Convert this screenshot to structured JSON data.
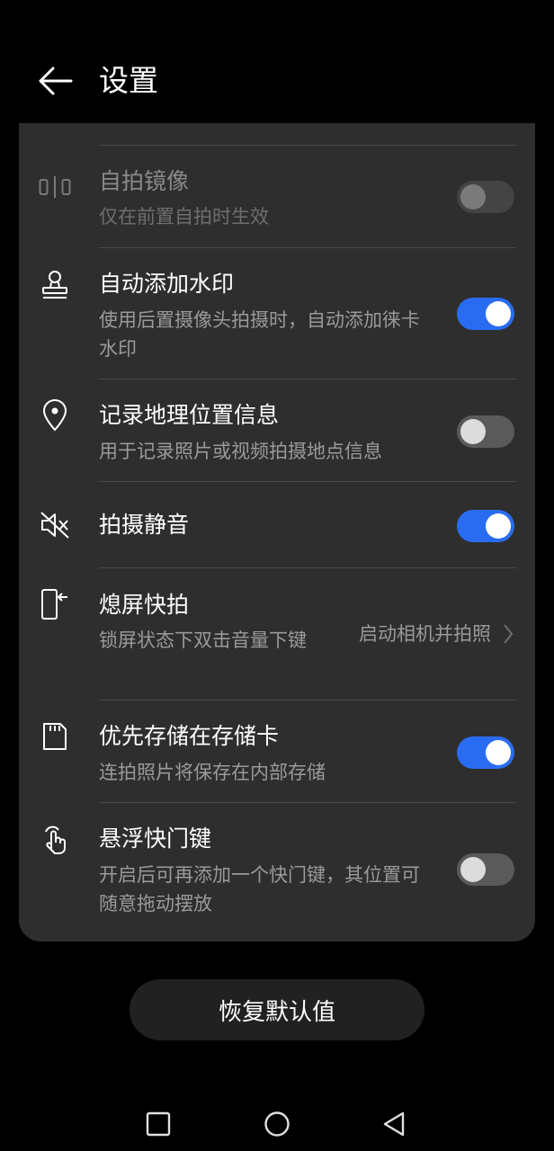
{
  "header": {
    "title": "设置",
    "back_icon": "arrow-left-icon"
  },
  "settings": [
    {
      "id": "mirror",
      "title": "自拍镜像",
      "subtitle": "仅在前置自拍时生效",
      "icon": "mirror-icon",
      "control": "toggle",
      "state": "off",
      "disabled": true
    },
    {
      "id": "watermark",
      "title": "自动添加水印",
      "subtitle": "使用后置摄像头拍摄时，自动添加徕卡水印",
      "icon": "stamp-icon",
      "control": "toggle",
      "state": "on"
    },
    {
      "id": "location",
      "title": "记录地理位置信息",
      "subtitle": "用于记录照片或视频拍摄地点信息",
      "icon": "location-pin-icon",
      "control": "toggle",
      "state": "off"
    },
    {
      "id": "mute",
      "title": "拍摄静音",
      "subtitle": "",
      "icon": "mute-speaker-icon",
      "control": "toggle",
      "state": "on"
    },
    {
      "id": "quick_snap",
      "title": "熄屏快拍",
      "subtitle": "锁屏状态下双击音量下键",
      "icon": "phone-quick-snap-icon",
      "control": "value",
      "value": "启动相机并拍照"
    },
    {
      "id": "sd_card",
      "title": "优先存储在存储卡",
      "subtitle": "连拍照片将保存在内部存储",
      "icon": "sd-card-icon",
      "control": "toggle",
      "state": "on"
    },
    {
      "id": "floating_shutter",
      "title": "悬浮快门键",
      "subtitle": "开启后可再添加一个快门键，其位置可随意拖动摆放",
      "icon": "touch-hand-icon",
      "control": "toggle",
      "state": "off"
    }
  ],
  "reset_button": {
    "label": "恢复默认值"
  },
  "nav_bar": {
    "recent": "square-recent-icon",
    "home": "circle-home-icon",
    "back": "triangle-back-icon"
  },
  "colors": {
    "accent": "#2a6cf1",
    "card": "#2e2e2e",
    "background": "#000000",
    "subtitle": "#9a9a9a"
  }
}
